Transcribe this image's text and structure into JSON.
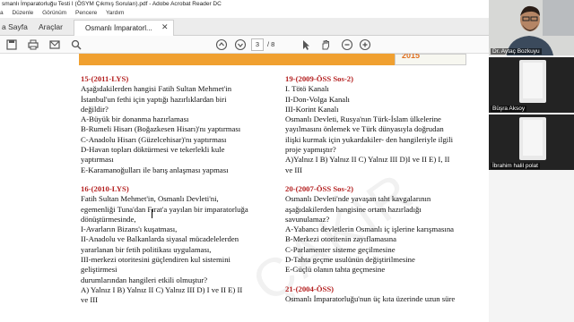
{
  "window": {
    "title": "smanlı İmparatorluğu Testi I (ÖSYM Çıkmış Soruları).pdf - Adobe Acrobat Reader DC"
  },
  "menu": [
    "a",
    "Düzenle",
    "Görünüm",
    "Pencere",
    "Yardım"
  ],
  "tabs": {
    "home": "a Sayfa",
    "tools": "Araçlar",
    "document": "Osmanlı İmparatorl..."
  },
  "toolbar": {
    "current_page": "3",
    "total_pages": "/ 8"
  },
  "banner": {
    "year": "2015"
  },
  "questions_left": [
    {
      "num": "15-(2011-LYS)",
      "lines": [
        "Aşağıdakilerden hangisi Fatih Sultan Mehmet'in",
        "İstanbul'un fethi için yaptığı hazırlıklardan biri",
        "değildir?",
        "A-Büyük bir donanma hazırlaması",
        "B-Rumeli Hisarı (Boğazkesen Hisarı)'nı yaptırması",
        "C-Anadolu Hisarı (Güzelcehisar)'nı yaptırması",
        "D-Havan topları döktürmesi ve tekerlekli kule",
        "yaptırması",
        "E-Karamanoğulları ile barış anlaşması yapması"
      ]
    },
    {
      "num": "16-(2010-LYS)",
      "lines": [
        "Fatih Sultan Mehmet'in, Osmanlı Devleti'ni,",
        "egemenliği Tuna'dan Fırat'a yayılan bir imparatorluğa",
        "dönüştürmesinde,",
        "I-Avarların Bizans'ı kuşatması,",
        "II-Anadolu ve Balkanlarda siyasal mücadelelerden",
        "yararlanan bir fetih politikası uygulaması,",
        "III-merkezi otoritesini güçlendiren kul sistemini",
        "geliştirmesi",
        "durumlarından hangileri etkili olmuştur?",
        "A) Yalnız I B) Yalnız II C) Yalnız III D) I ve II E) II",
        "ve III"
      ]
    }
  ],
  "questions_right": [
    {
      "num": "19-(2009-ÖSS Sos-2)",
      "lines": [
        "I. Tötö Kanalı",
        "II-Don-Volga Kanalı",
        "III-Korint Kanalı",
        "Osmanlı Devleti, Rusya'nın Türk-İslam ülkelerine",
        "yayılmasını önlemek ve Türk dünyasıyla doğrudan",
        "ilişki kurmak için yukardakiler- den hangileriyle ilgili",
        "proje yapmıştır?",
        "A)Yalnız I B) Yalnız II C) Yalnız III D)I ve II E) I, II",
        "ve III"
      ]
    },
    {
      "num": "20-(2007-ÖSS Sos-2)",
      "lines": [
        "Osmanlı Devleti'nde yavaşan taht kavgalarının",
        "aşağıdakilerden hangisine ortam hazırladığı",
        "savunulamaz?",
        "A-Yabancı devletlerin Osmanlı iç işlerine karışmasına",
        "B-Merkezi otoritenin zayıflamasına",
        "C-Parlamenter sisteme geçilmesine",
        "D-Tahta geçme usulünün değiştirilmesine",
        "E-Güçlü olanın tahta geçmesine"
      ]
    },
    {
      "num": "21-(2004-ÖSS)",
      "lines": [
        "Osmanlı İmparatorluğu'nun üç kıta üzerinde uzun süre"
      ]
    }
  ],
  "participants": [
    {
      "name": "Dr. Aytaç Bozkuyu"
    },
    {
      "name": "Büşra Aksoy"
    },
    {
      "name": "İbrahim halil polat"
    }
  ],
  "colors": {
    "banner": "#f0a030",
    "question_number": "#b42020",
    "tab_bar": "#ececec"
  }
}
